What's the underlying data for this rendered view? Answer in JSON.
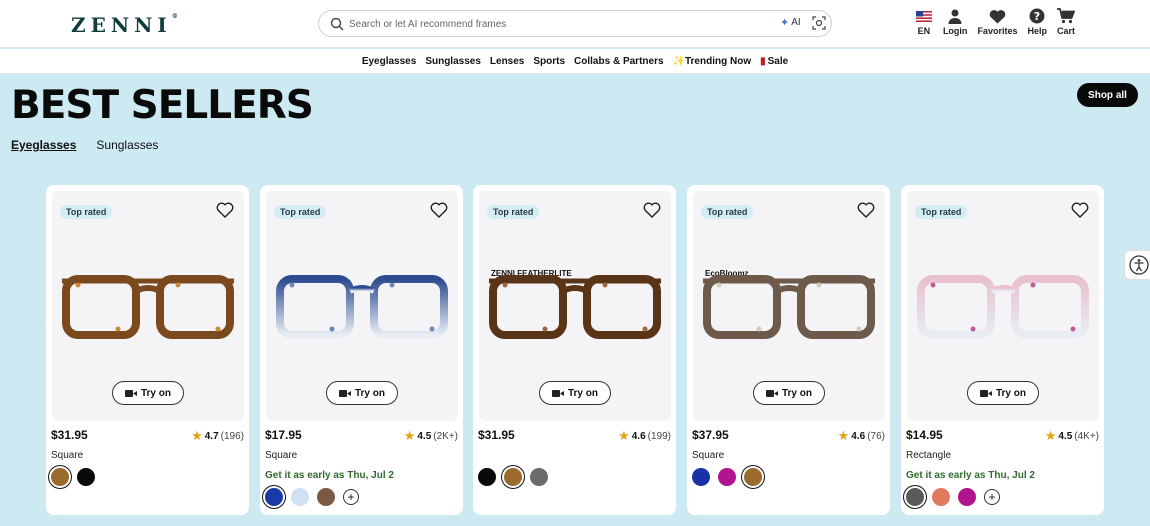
{
  "header": {
    "logo": "ZENNI",
    "search_placeholder": "Search or let AI recommend frames",
    "ai_label": "AI",
    "items": [
      {
        "label": "EN",
        "icon": "us-flag-icon"
      },
      {
        "label": "Login",
        "icon": "user-icon"
      },
      {
        "label": "Favorites",
        "icon": "heart-icon"
      },
      {
        "label": "Help",
        "icon": "help-icon"
      },
      {
        "label": "Cart",
        "icon": "cart-icon"
      }
    ]
  },
  "nav": {
    "items": [
      "Eyeglasses",
      "Sunglasses",
      "Lenses",
      "Sports",
      "Collabs & Partners"
    ],
    "trending": "Trending Now",
    "sale": "Sale"
  },
  "main": {
    "title": "BEST SELLERS",
    "shop_all": "Shop all",
    "tabs": [
      "Eyeglasses",
      "Sunglasses"
    ]
  },
  "cards": [
    {
      "badge": "Top rated",
      "price": "$31.95",
      "rating": "4.7",
      "count": "(196)",
      "shape": "Square",
      "delivery": "",
      "try_on": "Try on",
      "brand": "",
      "swatches": [
        "#9a6a2f",
        "#0a0a0a"
      ],
      "selected": 0
    },
    {
      "badge": "Top rated",
      "price": "$17.95",
      "rating": "4.5",
      "count": "(2K+)",
      "shape": "Square",
      "delivery": "Get it as early as Thu, Jul 2",
      "try_on": "Try on",
      "brand": "",
      "swatches": [
        "#1b3aa8",
        "#cfe1f3",
        "#7b5a45"
      ],
      "selected": 0,
      "more": "+"
    },
    {
      "badge": "Top rated",
      "price": "$31.95",
      "rating": "4.6",
      "count": "(199)",
      "shape": "",
      "delivery": "",
      "try_on": "Try on",
      "brand": "ZENNI FEATHERLITE",
      "swatches": [
        "#0a0a0a",
        "#9a6a2f",
        "#6b6b6b"
      ],
      "selected": 1
    },
    {
      "badge": "Top rated",
      "price": "$37.95",
      "rating": "4.6",
      "count": "(76)",
      "shape": "Square",
      "delivery": "",
      "try_on": "Try on",
      "brand": "EcoBloomz",
      "swatches": [
        "#1831a8",
        "#b0148e",
        "#9a6a2f"
      ],
      "selected": 2
    },
    {
      "badge": "Top rated",
      "price": "$14.95",
      "rating": "4.5",
      "count": "(4K+)",
      "shape": "Rectangle",
      "delivery": "Get it as early as Thu, Jul 2",
      "try_on": "Try on",
      "brand": "",
      "swatches": [
        "#5a5a5a",
        "#e07a5f",
        "#b0148e"
      ],
      "selected": 0,
      "more": "+"
    }
  ],
  "colors": {
    "accent": "#0a0a0a",
    "background": "#cde9f2",
    "trending": "#1e6f8e",
    "delivery": "#2f6b2f",
    "star": "#e3a20e"
  }
}
